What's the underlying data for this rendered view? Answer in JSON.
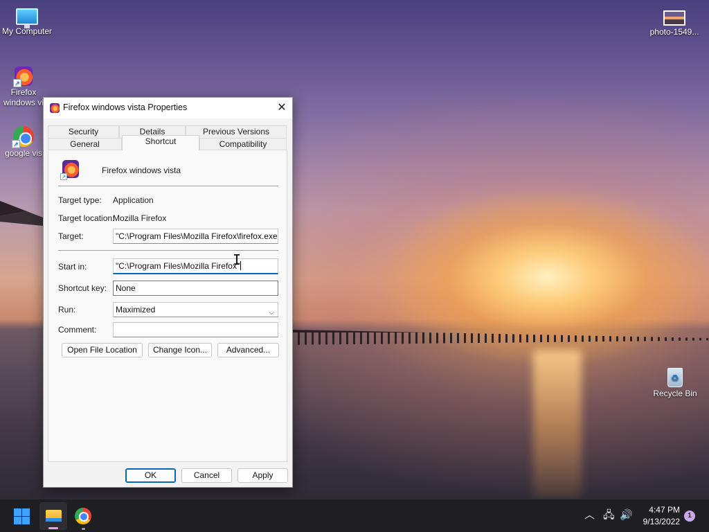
{
  "desktop": {
    "icons": [
      {
        "label": "My Computer"
      },
      {
        "label": "Firefox windows vi"
      },
      {
        "label": "google vis"
      },
      {
        "label": "photo-1549..."
      },
      {
        "label": "Recycle Bin"
      }
    ]
  },
  "dialog": {
    "title": "Firefox windows vista Properties",
    "close_glyph": "✕",
    "tabs": {
      "row1": [
        "Security",
        "Details",
        "Previous Versions"
      ],
      "row2": [
        "General",
        "Shortcut",
        "Compatibility"
      ],
      "active": "Shortcut"
    },
    "app_name": "Firefox windows vista",
    "fields": {
      "target_type_label": "Target type:",
      "target_type_value": "Application",
      "target_location_label": "Target location:",
      "target_location_value": "Mozilla Firefox",
      "target_label": "Target:",
      "target_value": "\"C:\\Program Files\\Mozilla Firefox\\firefox.exe\"",
      "start_in_label": "Start in:",
      "start_in_value": "\"C:\\Program Files\\Mozilla Firefox\"",
      "shortcut_key_label": "Shortcut key:",
      "shortcut_key_value": "None",
      "run_label": "Run:",
      "run_value": "Maximized",
      "comment_label": "Comment:",
      "comment_value": ""
    },
    "buttons": {
      "open_file_location": "Open File Location",
      "change_icon": "Change Icon...",
      "advanced": "Advanced...",
      "ok": "OK",
      "cancel": "Cancel",
      "apply": "Apply"
    }
  },
  "taskbar": {
    "tray": {
      "chevron": "︿",
      "network": "🖧",
      "volume": "🔊"
    },
    "clock": {
      "time": "4:47 PM",
      "date": "9/13/2022"
    },
    "notification_count": "1"
  },
  "colors": {
    "accent": "#0067c0",
    "taskbar": "#1f1f23",
    "dialog_bg": "#f3f3f3"
  }
}
